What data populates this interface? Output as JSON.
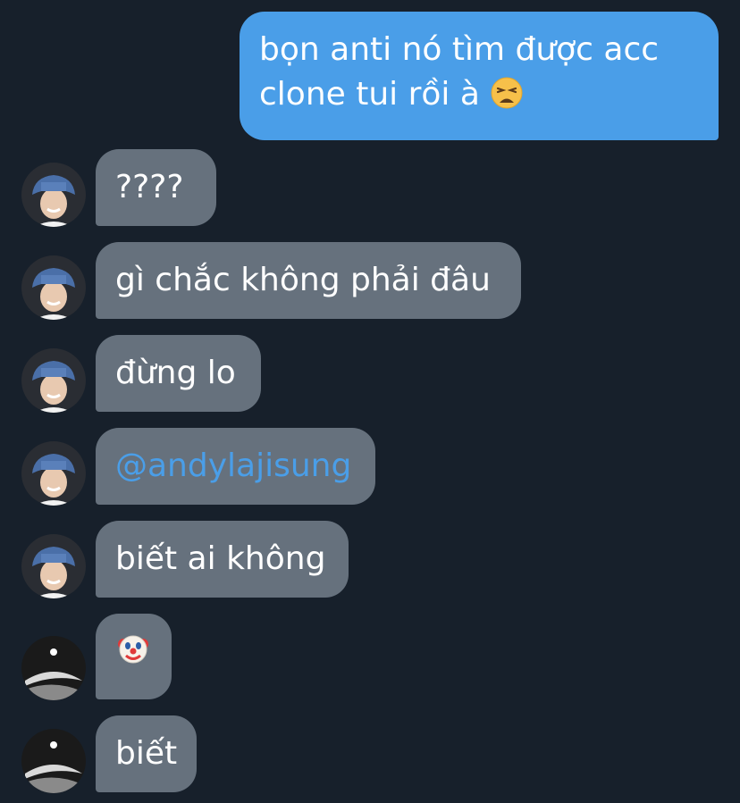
{
  "messages": {
    "m1": {
      "text": "bọn anti nó tìm được acc clone tui rồi à"
    },
    "m2": {
      "text": "????"
    },
    "m3": {
      "text": "gì chắc không phải đâu"
    },
    "m4": {
      "text": "đừng lo"
    },
    "m5": {
      "text": "@andylajisung"
    },
    "m6": {
      "text": "biết ai không"
    },
    "m8": {
      "text": "biết"
    }
  },
  "colors": {
    "background": "#17202b",
    "sent_bubble": "#4a9ee8",
    "received_bubble": "#66717d",
    "mention": "#4a9ee8"
  },
  "icons": {
    "tired_emoji": "tired-face-emoji",
    "clown_emoji": "clown-face-emoji"
  }
}
